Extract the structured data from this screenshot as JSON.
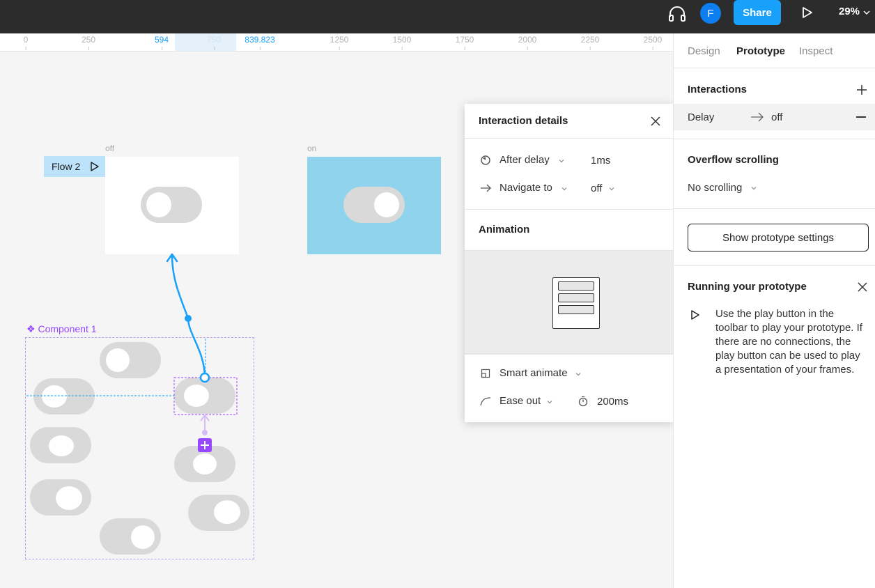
{
  "topbar": {
    "avatar_letter": "F",
    "share_label": "Share",
    "zoom": "29%"
  },
  "ruler": {
    "ticks": [
      "0",
      "250",
      "594",
      "750",
      "839.823",
      "1250",
      "1500",
      "1750",
      "2000",
      "2250",
      "2500"
    ]
  },
  "canvas": {
    "frame_off_label": "off",
    "frame_on_label": "on",
    "flow_label": "Flow 2",
    "component_label": "Component 1",
    "colors": {
      "frame_on_bg": "#8fd3ed",
      "toggle_gray": "#d9d9d9",
      "connector": "#18a0fb",
      "component": "#9747ff"
    }
  },
  "popup": {
    "title": "Interaction details",
    "trigger_label": "After delay",
    "trigger_value": "1ms",
    "action_label": "Navigate to",
    "action_value": "off",
    "animation_title": "Animation",
    "animation_type": "Smart animate",
    "easing": "Ease out",
    "duration": "200ms"
  },
  "panel": {
    "tabs": [
      "Design",
      "Prototype",
      "Inspect"
    ],
    "interactions_title": "Interactions",
    "delay_label": "Delay",
    "delay_target": "off",
    "overflow_title": "Overflow scrolling",
    "overflow_value": "No scrolling",
    "settings_button": "Show prototype settings",
    "running_title": "Running your prototype",
    "running_text": "Use the play button in the toolbar to play your prototype. If there are no connections, the play button can be used to play a presentation of your frames."
  }
}
